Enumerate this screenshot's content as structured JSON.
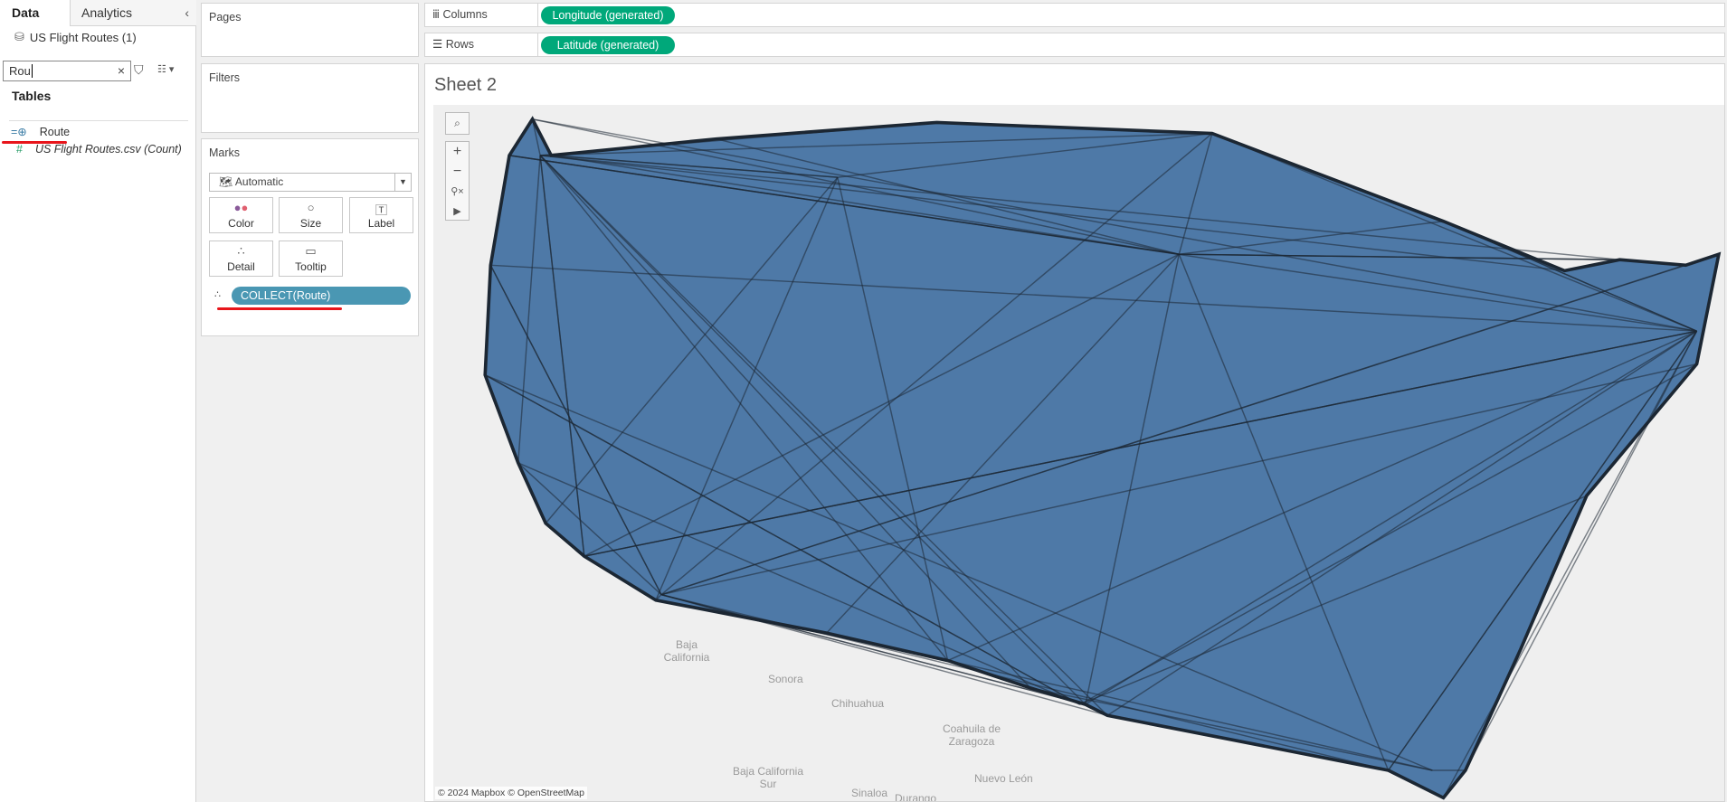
{
  "left": {
    "tabs": {
      "data": "Data",
      "analytics": "Analytics"
    },
    "datasource": "US Flight Routes (1)",
    "search_value": "Rou",
    "tables_heading": "Tables",
    "fields": [
      {
        "name": "Route",
        "type": "geographic"
      },
      {
        "name": "US Flight Routes.csv (Count)",
        "type": "measure"
      }
    ]
  },
  "pages": {
    "title": "Pages"
  },
  "filters": {
    "title": "Filters"
  },
  "marks": {
    "title": "Marks",
    "type": "Automatic",
    "buttons": {
      "color": "Color",
      "size": "Size",
      "label": "Label",
      "detail": "Detail",
      "tooltip": "Tooltip"
    },
    "detail_pill": "COLLECT(Route)"
  },
  "shelves": {
    "columns_label": "Columns",
    "columns_pill": "Longitude (generated)",
    "rows_label": "Rows",
    "rows_pill": "Latitude (generated)"
  },
  "sheet": {
    "title": "Sheet 2",
    "attribution": "© 2024 Mapbox © OpenStreetMap",
    "map_labels": {
      "baja": "Baja California",
      "sonora": "Sonora",
      "chihuahua": "Chihuahua",
      "coahuila": "Coahuila de Zaragoza",
      "bcs": "Baja California Sur",
      "nuevo_leon": "Nuevo León",
      "sinaloa": "Sinaloa",
      "durango": "Durango"
    },
    "route_color": "#4e79a7"
  },
  "colors": {
    "pill_dimension": "#00a87a",
    "pill_detail": "#4a97b3",
    "highlight": "#e8151b"
  }
}
